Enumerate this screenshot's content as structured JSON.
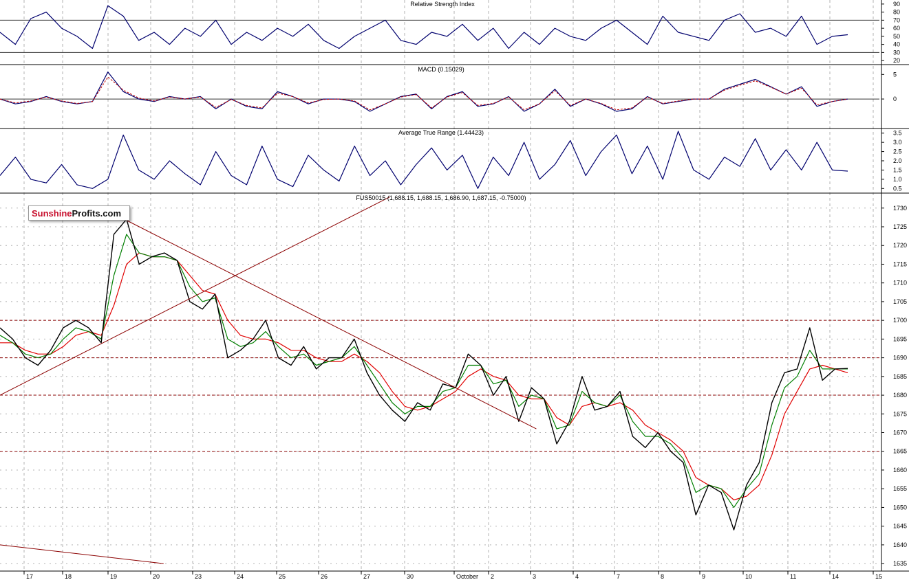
{
  "brand": {
    "part1": "Sunshine",
    "part2": "Profits.com"
  },
  "colors": {
    "price": "#000000",
    "ma_fast": "#007f00",
    "ma_slow": "#e00000",
    "indicator": "#00006e",
    "macd_signal": "#c00000",
    "trendline": "#8b0000",
    "support": "#8b0000",
    "grid": "#b0b0b0"
  },
  "chart_data": [
    {
      "type": "line",
      "title": "Relative Strength Index",
      "ylim": [
        15,
        95
      ],
      "yticks": [
        "90",
        "80",
        "70",
        "60",
        "50",
        "40",
        "30",
        "20"
      ],
      "reference_lines": [
        70,
        30
      ],
      "series": [
        {
          "values": [
            55,
            40,
            72,
            80,
            60,
            50,
            35,
            88,
            75,
            45,
            55,
            40,
            60,
            50,
            70,
            40,
            55,
            45,
            60,
            50,
            65,
            45,
            35,
            50,
            60,
            70,
            45,
            40,
            55,
            50,
            65,
            45,
            60,
            35,
            55,
            40,
            60,
            50,
            45,
            60,
            70,
            55,
            40,
            75,
            55,
            50,
            45,
            70,
            78,
            55,
            60,
            50,
            75,
            40,
            50,
            52
          ]
        }
      ]
    },
    {
      "type": "line",
      "title": "MACD (0.15029)",
      "ylim": [
        -6,
        7
      ],
      "yticks": [
        "5",
        "0"
      ],
      "series": [
        {
          "values": [
            0,
            -1,
            -0.5,
            0.5,
            -0.5,
            -1,
            -0.5,
            5.5,
            1.5,
            0,
            -0.5,
            0.5,
            0,
            0.5,
            -2,
            0,
            -1.5,
            -2,
            1.5,
            0.5,
            -1,
            0,
            0,
            -0.5,
            -2.5,
            -1,
            0.5,
            1,
            -2,
            0.5,
            1.5,
            -1.5,
            -1,
            0.5,
            -2.5,
            -1,
            2,
            -1.5,
            0,
            -1,
            -2.5,
            -2,
            0.5,
            -1,
            -0.5,
            0,
            0,
            2,
            3,
            4,
            2.5,
            1,
            2.5,
            -1.5,
            -0.5,
            0
          ]
        },
        {
          "values": [
            0,
            -0.8,
            -0.4,
            0.4,
            -0.4,
            -0.9,
            -0.5,
            4.5,
            1.8,
            0.2,
            -0.4,
            0.4,
            0,
            0.4,
            -1.7,
            -0.1,
            -1.3,
            -1.8,
            1.2,
            0.5,
            -0.8,
            -0.1,
            0,
            -0.4,
            -2.2,
            -1,
            0.4,
            0.9,
            -1.8,
            0.4,
            1.3,
            -1.3,
            -0.9,
            0.4,
            -2.2,
            -1,
            1.7,
            -1.3,
            0,
            -0.9,
            -2.2,
            -1.8,
            0.4,
            -0.9,
            -0.4,
            0,
            0,
            1.8,
            2.8,
            3.7,
            2.4,
            1,
            2.2,
            -1.2,
            -0.5,
            0
          ]
        }
      ]
    },
    {
      "type": "line",
      "title": "Average True Range (1.44423)",
      "ylim": [
        0.25,
        3.75
      ],
      "yticks": [
        "3.5",
        "3.0",
        "2.5",
        "2.0",
        "1.5",
        "1.0",
        "0.5"
      ],
      "series": [
        {
          "values": [
            1.2,
            2.2,
            1.0,
            0.8,
            1.8,
            0.7,
            0.5,
            1.0,
            3.4,
            1.5,
            1.0,
            2.0,
            1.3,
            0.7,
            2.5,
            1.2,
            0.7,
            2.8,
            1.0,
            0.6,
            2.3,
            1.5,
            0.9,
            2.8,
            1.2,
            2.0,
            0.7,
            1.8,
            2.7,
            1.5,
            2.3,
            0.5,
            2.2,
            1.2,
            3.0,
            1.0,
            1.8,
            3.1,
            1.2,
            2.5,
            3.4,
            1.3,
            2.8,
            1.0,
            3.6,
            1.5,
            1.0,
            2.2,
            1.7,
            3.2,
            1.5,
            2.6,
            1.5,
            3.0,
            1.5,
            1.44
          ]
        }
      ]
    },
    {
      "type": "line",
      "title": "FUS50015 (1,688.15, 1,688.15, 1,686.90, 1,687.15, -0.75000)",
      "ylim": [
        1633,
        1734
      ],
      "yticks": [
        "1730",
        "1725",
        "1720",
        "1715",
        "1710",
        "1705",
        "1700",
        "1695",
        "1690",
        "1685",
        "1680",
        "1675",
        "1670",
        "1665",
        "1660",
        "1655",
        "1650",
        "1645",
        "1640",
        "1635"
      ],
      "x_tick_labels": [
        "17",
        "18",
        "19",
        "20",
        "23",
        "24",
        "25",
        "26",
        "27",
        "30",
        "October",
        "2",
        "3",
        "4",
        "7",
        "8",
        "9",
        "10",
        "11",
        "14",
        "15"
      ],
      "support_levels": [
        1700,
        1690,
        1680,
        1665
      ],
      "series": [
        {
          "name": "",
          "values": [
            1698,
            1695,
            1690,
            1688,
            1692,
            1698,
            1700,
            1698,
            1694,
            1723,
            1727,
            1715,
            1717,
            1718,
            1716,
            1705,
            1703,
            1707,
            1690,
            1692,
            1695,
            1700,
            1690,
            1688,
            1693,
            1687,
            1690,
            1690,
            1695,
            1686,
            1680,
            1676,
            1673,
            1678,
            1676,
            1683,
            1682,
            1691,
            1688,
            1680,
            1685,
            1673,
            1682,
            1679,
            1667,
            1673,
            1685,
            1676,
            1677,
            1681,
            1669,
            1666,
            1670,
            1665,
            1662,
            1648,
            1656,
            1654,
            1644,
            1656,
            1662,
            1678,
            1686,
            1687,
            1698,
            1684,
            1687,
            1687.15
          ]
        },
        {
          "name": "",
          "values": [
            1696,
            1694,
            1691,
            1690,
            1691,
            1695,
            1698,
            1697,
            1695,
            1712,
            1723,
            1718,
            1717,
            1717,
            1716,
            1709,
            1705,
            1706,
            1695,
            1693,
            1694,
            1697,
            1693,
            1690,
            1691,
            1688,
            1689,
            1690,
            1693,
            1688,
            1683,
            1678,
            1675,
            1677,
            1677,
            1681,
            1682,
            1688,
            1688,
            1683,
            1684,
            1677,
            1680,
            1679,
            1671,
            1672,
            1681,
            1678,
            1677,
            1680,
            1673,
            1669,
            1669,
            1667,
            1663,
            1654,
            1656,
            1655,
            1650,
            1655,
            1659,
            1672,
            1682,
            1685,
            1692,
            1687,
            1687,
            1687
          ]
        },
        {
          "name": "",
          "values": [
            1694,
            1694,
            1692,
            1691,
            1691,
            1693,
            1696,
            1697,
            1696,
            1704,
            1715,
            1718,
            1717,
            1717,
            1716,
            1712,
            1708,
            1707,
            1700,
            1696,
            1695,
            1695,
            1694,
            1692,
            1692,
            1690,
            1689,
            1689,
            1691,
            1689,
            1686,
            1681,
            1677,
            1676,
            1677,
            1679,
            1681,
            1685,
            1687,
            1685,
            1684,
            1680,
            1679,
            1679,
            1674,
            1672,
            1677,
            1678,
            1677,
            1678,
            1676,
            1672,
            1670,
            1668,
            1665,
            1658,
            1656,
            1655,
            1652,
            1653,
            1656,
            1664,
            1675,
            1681,
            1687,
            1688,
            1687,
            1686
          ]
        }
      ],
      "trendlines": [
        {
          "from": {
            "x": 0,
            "y": 1680
          },
          "to": {
            "x": 0.429,
            "y": 1733
          }
        },
        {
          "from": {
            "x": 0.137,
            "y": 1727
          },
          "to": {
            "x": 0.59,
            "y": 1671
          }
        },
        {
          "from": {
            "x": 0,
            "y": 1640
          },
          "to": {
            "x": 0.18,
            "y": 1635
          }
        }
      ]
    }
  ]
}
